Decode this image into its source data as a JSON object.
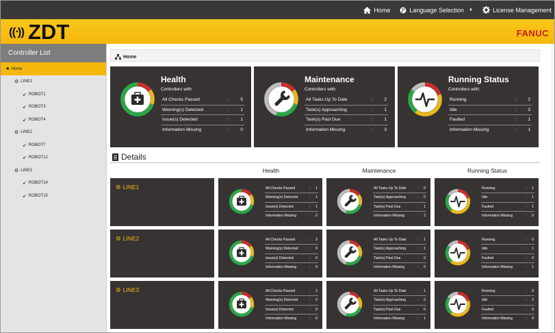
{
  "topnav": {
    "home": "Home",
    "language": "Language Selection",
    "license": "License Management"
  },
  "brand": {
    "logo": "ZDT",
    "company": "FANUC",
    "accent": "#f5b80d",
    "panel_bg": "#373333"
  },
  "sidebar": {
    "title": "Controller List",
    "items": [
      {
        "label": "Home",
        "level": 0,
        "active": true
      },
      {
        "label": "LINE1",
        "level": 1
      },
      {
        "label": "ROBOT1",
        "level": 2
      },
      {
        "label": "ROBOT3",
        "level": 2
      },
      {
        "label": "ROBOT4",
        "level": 2
      },
      {
        "label": "LINE2",
        "level": 1
      },
      {
        "label": "ROBOT7",
        "level": 2
      },
      {
        "label": "ROBOT12",
        "level": 2
      },
      {
        "label": "LINE3",
        "level": 1
      },
      {
        "label": "ROBOT14",
        "level": 2
      },
      {
        "label": "ROBOT15",
        "level": 2
      }
    ]
  },
  "breadcrumb": "Home",
  "summary": {
    "subtitle": "Controllers with:",
    "health": {
      "title": "Health",
      "rows": [
        {
          "label": "All Checks Passed",
          "value": "5"
        },
        {
          "label": "Warning(s) Detected",
          "value": "1"
        },
        {
          "label": "Issue(s) Detected",
          "value": "1"
        },
        {
          "label": "Information Missing",
          "value": "0"
        }
      ]
    },
    "maintenance": {
      "title": "Maintenance",
      "rows": [
        {
          "label": "All Tasks Up To Date",
          "value": "2"
        },
        {
          "label": "Task(s) Approaching",
          "value": "1"
        },
        {
          "label": "Task(s) Past Due",
          "value": "1"
        },
        {
          "label": "Information Missing",
          "value": "3"
        }
      ]
    },
    "running": {
      "title": "Running Status",
      "rows": [
        {
          "label": "Running",
          "value": "2"
        },
        {
          "label": "Idle",
          "value": "3"
        },
        {
          "label": "Faulted",
          "value": "1"
        },
        {
          "label": "Information Missing",
          "value": "1"
        }
      ]
    }
  },
  "details": {
    "title": "Details",
    "col_health": "Health",
    "col_maintenance": "Maintenance",
    "col_running": "Running Status",
    "lines": [
      {
        "name": "LINE1",
        "health": [
          [
            "All Checks Passed",
            "1"
          ],
          [
            "Warning(s) Detected",
            "1"
          ],
          [
            "Issue(s) Detected",
            "1"
          ],
          [
            "Information Missing",
            "0"
          ]
        ],
        "maintenance": [
          [
            "All Tasks Up To Date",
            "0"
          ],
          [
            "Task(s) Approaching",
            "0"
          ],
          [
            "Task(s) Past Due",
            "1"
          ],
          [
            "Information Missing",
            "2"
          ]
        ],
        "running": [
          [
            "Running",
            "1"
          ],
          [
            "Idle",
            "1"
          ],
          [
            "Faulted",
            "1"
          ],
          [
            "Information Missing",
            "0"
          ]
        ]
      },
      {
        "name": "LINE2",
        "health": [
          [
            "All Checks Passed",
            "2"
          ],
          [
            "Warning(s) Detected",
            "0"
          ],
          [
            "Issue(s) Detected",
            "0"
          ],
          [
            "Information Missing",
            "0"
          ]
        ],
        "maintenance": [
          [
            "All Tasks Up To Date",
            "1"
          ],
          [
            "Task(s) Approaching",
            "1"
          ],
          [
            "Task(s) Past Due",
            "0"
          ],
          [
            "Information Missing",
            "0"
          ]
        ],
        "running": [
          [
            "Running",
            "0"
          ],
          [
            "Idle",
            "1"
          ],
          [
            "Faulted",
            "0"
          ],
          [
            "Information Missing",
            "1"
          ]
        ]
      },
      {
        "name": "LINE3",
        "health": [
          [
            "All Checks Passed",
            "2"
          ],
          [
            "Warning(s) Detected",
            "0"
          ],
          [
            "Issue(s) Detected",
            "0"
          ],
          [
            "Information Missing",
            "0"
          ]
        ],
        "maintenance": [
          [
            "All Tasks Up To Date",
            "1"
          ],
          [
            "Task(s) Approaching",
            "0"
          ],
          [
            "Task(s) Past Due",
            "0"
          ],
          [
            "Information Missing",
            "1"
          ]
        ],
        "running": [
          [
            "Running",
            "0"
          ],
          [
            "Idle",
            "2"
          ],
          [
            "Faulted",
            "0"
          ],
          [
            "Information Missing",
            "0"
          ]
        ]
      }
    ]
  }
}
